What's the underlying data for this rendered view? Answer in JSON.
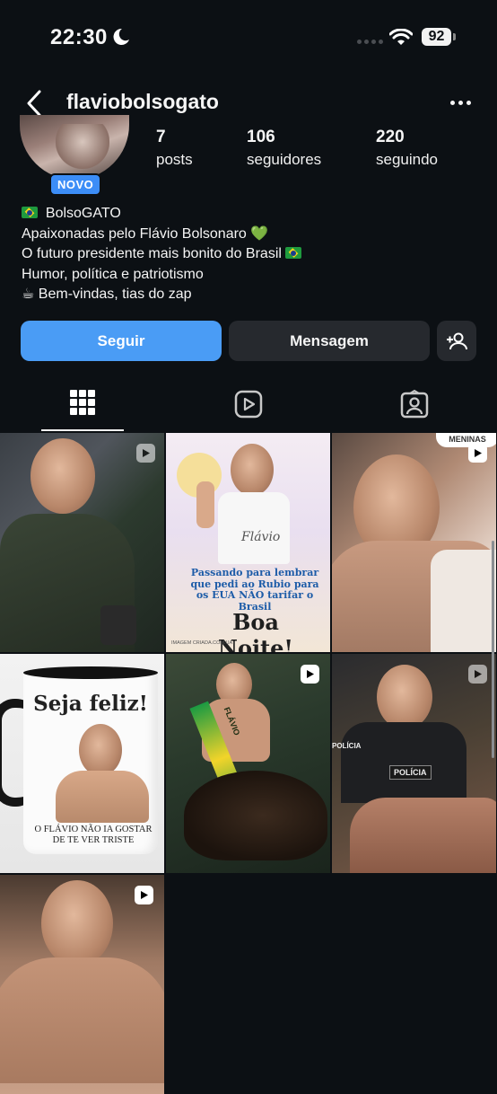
{
  "status_bar": {
    "time": "22:30",
    "battery": "92"
  },
  "header": {
    "username": "flaviobolsogato"
  },
  "profile": {
    "badge": "NOVO",
    "stats": [
      {
        "value": "7",
        "label": "posts"
      },
      {
        "value": "106",
        "label": "seguidores"
      },
      {
        "value": "220",
        "label": "seguindo"
      }
    ],
    "bio": {
      "name": "BolsoGATO",
      "line1": "Apaixonadas pelo Flávio Bolsonaro",
      "line2": "O futuro presidente mais bonito do Brasil",
      "line3": "Humor, política e patriotismo",
      "line4": "Bem-vindas, tias do zap"
    }
  },
  "actions": {
    "follow": "Seguir",
    "message": "Mensagem"
  },
  "tabs": [
    "grid-icon",
    "reels-icon",
    "tagged-icon"
  ],
  "posts": {
    "p2_text": "Passando para lembrar que pedi ao Rubio para os EUA NÃO tarifar o Brasil",
    "p2_boa": "Boa Noite!",
    "p2_apron": "Flávio",
    "p2_credit": "IMAGEM CRIADA.COM.UA",
    "p3_bubble": "MENINAS",
    "p4_title": "Seja feliz!",
    "p4_caption": "O FLÁVIO NÃO IA GOSTAR DE TE VER TRISTE",
    "p5_sash": "FLÁVIO",
    "p6_badge": "POLÍCIA",
    "p6_sleeve": "POLÍCIA"
  }
}
